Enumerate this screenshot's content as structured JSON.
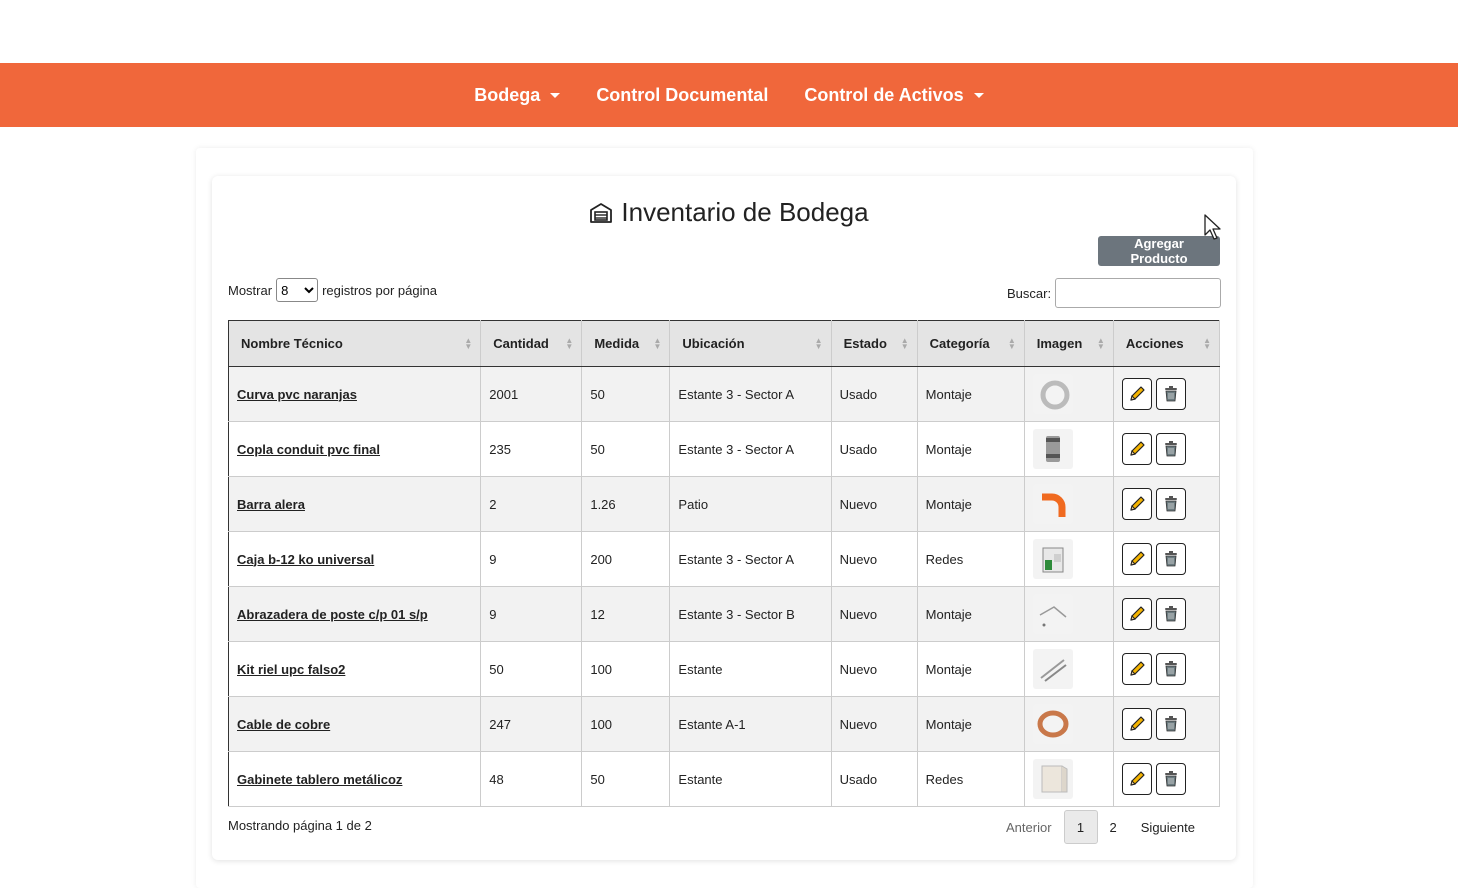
{
  "nav": {
    "items": [
      {
        "label": "Bodega",
        "dropdown": true
      },
      {
        "label": "Control Documental",
        "dropdown": false
      },
      {
        "label": "Control de Activos",
        "dropdown": true
      }
    ],
    "accent": "#f0673b"
  },
  "page": {
    "title": "Inventario de Bodega",
    "title_icon": "warehouse-icon",
    "add_button": "Agregar Producto"
  },
  "controls": {
    "show_prefix": "Mostrar",
    "show_value": "8",
    "show_suffix": "registros por página",
    "search_label": "Buscar:",
    "search_value": ""
  },
  "table": {
    "columns": [
      "Nombre Técnico",
      "Cantidad",
      "Medida",
      "Ubicación",
      "Estado",
      "Categoría",
      "Imagen",
      "Acciones"
    ],
    "rows": [
      {
        "name": "Curva pvc naranjas",
        "qty": "2001",
        "measure": "50",
        "location": "Estante 3 - Sector A",
        "state": "Usado",
        "category": "Montaje",
        "image": "pvc-curve-thumb"
      },
      {
        "name": "Copla conduit pvc final",
        "qty": "235",
        "measure": "50",
        "location": "Estante 3 - Sector A",
        "state": "Usado",
        "category": "Montaje",
        "image": "conduit-coupling-thumb"
      },
      {
        "name": "Barra alera",
        "qty": "2",
        "measure": "1.26",
        "location": "Patio",
        "state": "Nuevo",
        "category": "Montaje",
        "image": "orange-elbow-thumb"
      },
      {
        "name": "Caja b-12 ko universal",
        "qty": "9",
        "measure": "200",
        "location": "Estante 3 - Sector A",
        "state": "Nuevo",
        "category": "Redes",
        "image": "box-thumb"
      },
      {
        "name": "Abrazadera de poste c/p 01 s/p",
        "qty": "9",
        "measure": "12",
        "location": "Estante 3 - Sector B",
        "state": "Nuevo",
        "category": "Montaje",
        "image": "clamp-thumb"
      },
      {
        "name": "Kit riel upc falso2",
        "qty": "50",
        "measure": "100",
        "location": "Estante",
        "state": "Nuevo",
        "category": "Montaje",
        "image": "rail-kit-thumb"
      },
      {
        "name": "Cable de cobre",
        "qty": "247",
        "measure": "100",
        "location": "Estante A-1",
        "state": "Nuevo",
        "category": "Montaje",
        "image": "copper-coil-thumb"
      },
      {
        "name": "Gabinete tablero metálicoz",
        "qty": "48",
        "measure": "50",
        "location": "Estante",
        "state": "Usado",
        "category": "Redes",
        "image": "cabinet-thumb"
      }
    ]
  },
  "footer": {
    "info": "Mostrando página 1 de 2",
    "prev": "Anterior",
    "pages": [
      "1",
      "2"
    ],
    "current_page": "1",
    "next": "Siguiente"
  }
}
